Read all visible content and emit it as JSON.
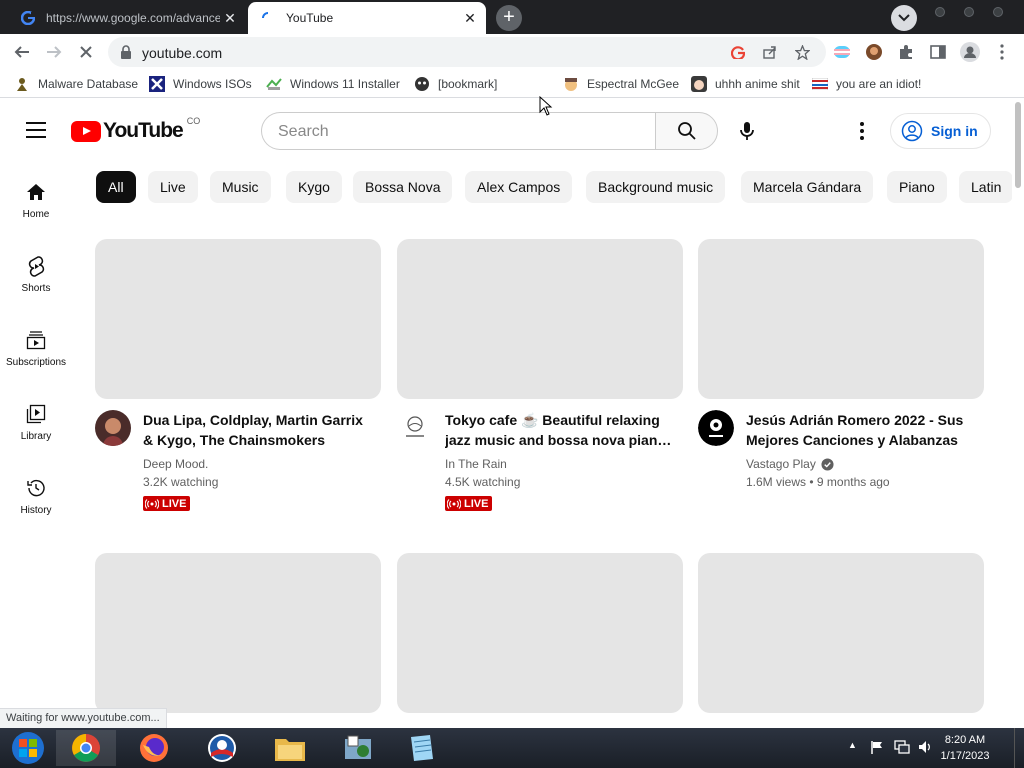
{
  "tabs": [
    {
      "title": "https://www.google.com/advanced_search",
      "close": "✕"
    },
    {
      "title": "YouTube",
      "close": "✕"
    }
  ],
  "new_tab": "+",
  "address": {
    "url": "youtube.com"
  },
  "bookmarks": [
    {
      "label": "Malware Database"
    },
    {
      "label": "Windows ISOs"
    },
    {
      "label": "Windows 11 Installer"
    },
    {
      "label": "[bookmark]"
    },
    {
      "label": "Espectral McGee"
    },
    {
      "label": "uhhh anime shit"
    },
    {
      "label": "you are an idiot!"
    }
  ],
  "youtube": {
    "logo_text": "YouTube",
    "country": "CO",
    "search_placeholder": "Search",
    "sign_in": "Sign in"
  },
  "sidebar": [
    {
      "label": "Home",
      "icon": "home-icon"
    },
    {
      "label": "Shorts",
      "icon": "shorts-icon"
    },
    {
      "label": "Subscriptions",
      "icon": "subscriptions-icon"
    },
    {
      "label": "Library",
      "icon": "library-icon"
    },
    {
      "label": "History",
      "icon": "history-icon"
    }
  ],
  "chips": [
    "All",
    "Live",
    "Music",
    "Kygo",
    "Bossa Nova",
    "Alex Campos",
    "Background music",
    "Marcela Gándara",
    "Piano",
    "Latin"
  ],
  "videos": [
    {
      "title": "Dua Lipa, Coldplay, Martin Garrix & Kygo, The Chainsmokers Style…",
      "channel": "Deep Mood.",
      "stats": "3.2K watching",
      "badge": "LIVE"
    },
    {
      "title": "Tokyo cafe ☕ Beautiful relaxing jazz music and bossa nova pian…",
      "channel": "In The Rain",
      "stats": "4.5K watching",
      "badge": "LIVE"
    },
    {
      "title": "Jesús Adrián Romero 2022 - Sus Mejores Canciones y Alabanzas",
      "channel": "Vastago Play",
      "stats": "1.6M views • 9 months ago",
      "verified": true
    }
  ],
  "status": "Waiting for www.youtube.com...",
  "clock": {
    "time": "8:20 AM",
    "date": "1/17/2023"
  },
  "colors": {
    "yt_red": "#ff0000",
    "live_red": "#cc0000",
    "link_blue": "#065fd4"
  }
}
